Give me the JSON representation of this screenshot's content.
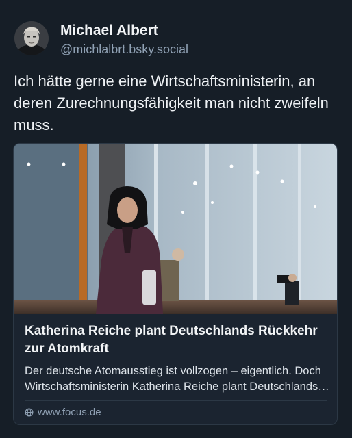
{
  "author": {
    "display_name": "Michael Albert",
    "handle": "@michlalbrt.bsky.social"
  },
  "post": {
    "text": "Ich hätte gerne eine Wirtschaftsministerin, an deren Zurechnungsfähigkeit man nicht zweifeln muss."
  },
  "link_card": {
    "title": "Katherina Reiche plant Deutschlands Rückkehr zur Atomkraft",
    "description": "Der deutsche Atomausstieg ist vollzogen – eigentlich. Doch Wirtschaftsministerin Katherina Reiche plant Deutschlands Rückkehr zur Atomkraft.",
    "domain": "www.focus.de",
    "domain_icon": "globe-icon"
  },
  "colors": {
    "background": "#161e27",
    "card_background": "#1b2430",
    "card_border": "#2c3845",
    "muted_text": "#8fa0b3"
  }
}
